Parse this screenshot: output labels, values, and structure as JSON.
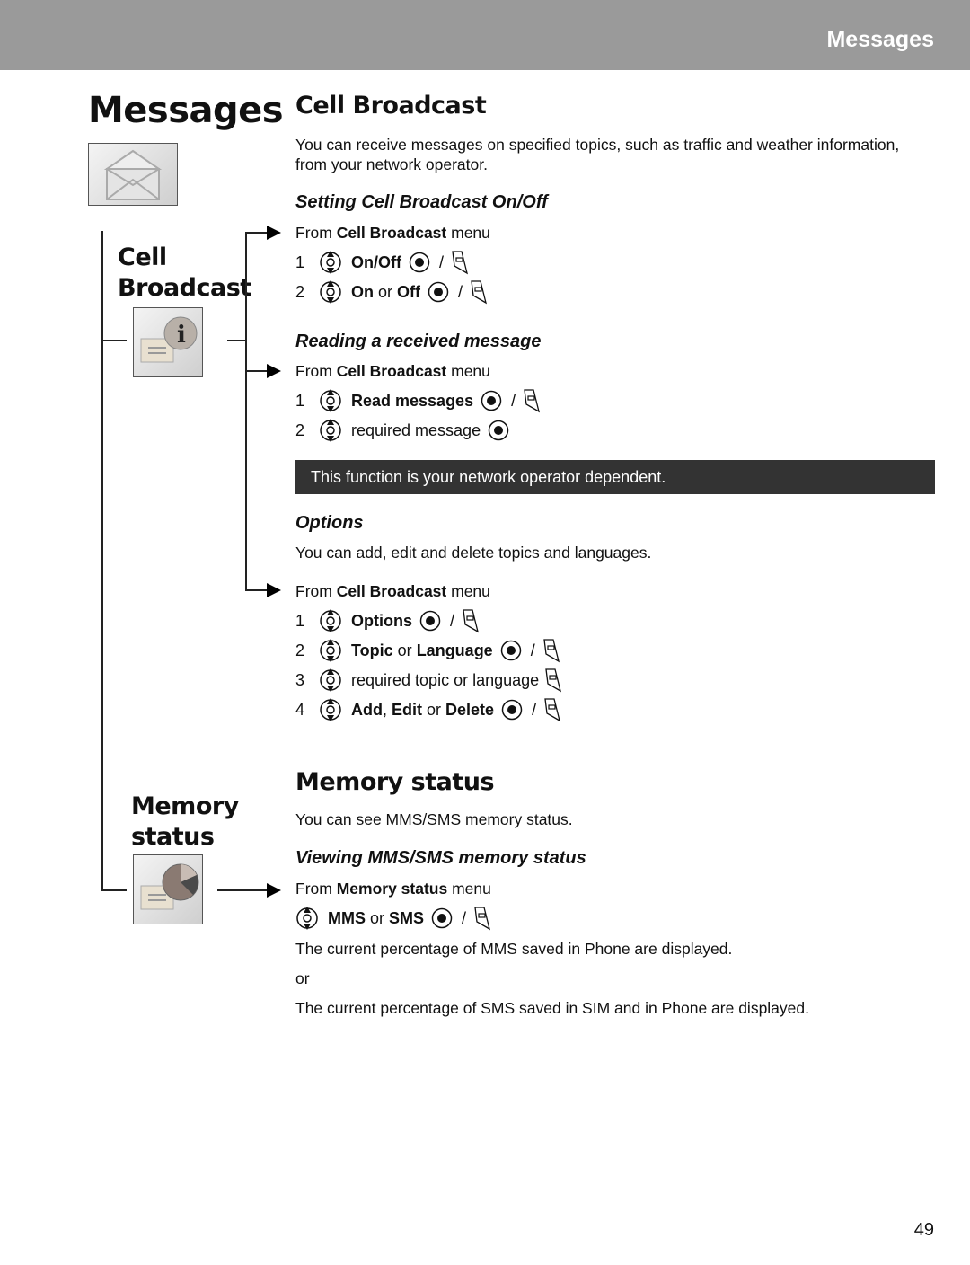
{
  "header": {
    "title": "Messages"
  },
  "chapter_title": "Messages",
  "icons": {
    "chapter": "envelope-icon",
    "cell_broadcast": "info-message-icon",
    "memory_status": "pie-chart-message-icon",
    "navigate": "navigation-key-icon",
    "select": "center-select-key-icon",
    "softkey": "soft-key-icon"
  },
  "side_labels": {
    "cell_broadcast": [
      "Cell",
      "Broadcast"
    ],
    "memory_status": [
      "Memory",
      "status"
    ]
  },
  "cell_broadcast": {
    "title": "Cell Broadcast",
    "intro": "You can receive messages on specified topics, such as traffic and weather information, from your network operator.",
    "setting": {
      "title": "Setting Cell Broadcast On/Off",
      "from_prefix": "From ",
      "from_menu": "Cell Broadcast",
      "from_suffix": " menu",
      "steps": [
        {
          "num": "1",
          "parts": [
            {
              "t": "On/Off",
              "b": true
            }
          ],
          "select": true,
          "softkey": true
        },
        {
          "num": "2",
          "parts": [
            {
              "t": "On",
              "b": true
            },
            {
              "t": " or ",
              "b": false
            },
            {
              "t": "Off",
              "b": true
            }
          ],
          "select": true,
          "softkey": true
        }
      ]
    },
    "reading": {
      "title": "Reading a received message",
      "from_prefix": "From ",
      "from_menu": "Cell Broadcast",
      "from_suffix": " menu",
      "steps": [
        {
          "num": "1",
          "parts": [
            {
              "t": "Read messages",
              "b": true
            }
          ],
          "select": true,
          "softkey": true
        },
        {
          "num": "2",
          "parts": [
            {
              "t": "required message",
              "b": false
            }
          ],
          "select": true,
          "softkey": false
        }
      ]
    },
    "note": "This function is your network operator dependent.",
    "options": {
      "title": "Options",
      "intro": "You can add, edit and delete topics and languages.",
      "from_prefix": "From ",
      "from_menu": "Cell Broadcast",
      "from_suffix": " menu",
      "steps": [
        {
          "num": "1",
          "parts": [
            {
              "t": "Options",
              "b": true
            }
          ],
          "select": true,
          "softkey": true
        },
        {
          "num": "2",
          "parts": [
            {
              "t": "Topic",
              "b": true
            },
            {
              "t": " or ",
              "b": false
            },
            {
              "t": "Language",
              "b": true
            }
          ],
          "select": true,
          "softkey": true
        },
        {
          "num": "3",
          "parts": [
            {
              "t": "required topic or language",
              "b": false
            }
          ],
          "select": false,
          "softkey": true
        },
        {
          "num": "4",
          "parts": [
            {
              "t": "Add",
              "b": true
            },
            {
              "t": ", ",
              "b": false
            },
            {
              "t": "Edit",
              "b": true
            },
            {
              "t": " or ",
              "b": false
            },
            {
              "t": "Delete",
              "b": true
            }
          ],
          "select": true,
          "softkey": true
        }
      ]
    }
  },
  "memory_status": {
    "title": "Memory status",
    "intro": "You can see MMS/SMS memory status.",
    "viewing": {
      "title": "Viewing MMS/SMS memory status",
      "from_prefix": "From ",
      "from_menu": "Memory status",
      "from_suffix": " menu",
      "steps": [
        {
          "num": "",
          "parts": [
            {
              "t": "MMS",
              "b": true
            },
            {
              "t": " or ",
              "b": false
            },
            {
              "t": "SMS",
              "b": true
            }
          ],
          "select": true,
          "softkey": true
        }
      ],
      "result_mms": "The current percentage of MMS saved in Phone are displayed.",
      "or": "or",
      "result_sms": "The current percentage of SMS saved in SIM and in Phone are displayed."
    }
  },
  "page_number": "49"
}
